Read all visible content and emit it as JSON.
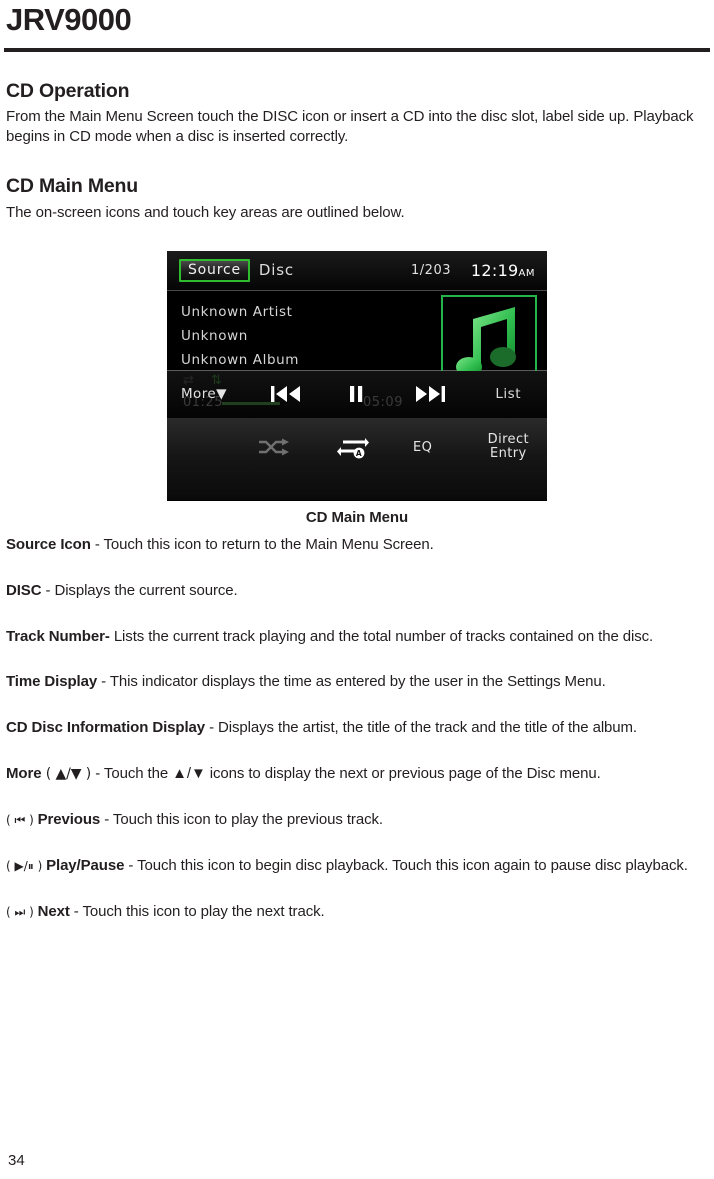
{
  "header": {
    "model_title": "JRV9000"
  },
  "sections": [
    {
      "heading": "CD Operation",
      "body": "From the Main Menu Screen touch the DISC icon or insert a CD into the disc slot, label side up. Playback begins in CD mode when a disc is inserted correctly."
    },
    {
      "heading": "CD Main Menu",
      "body": "The on-screen icons and touch key areas are outlined below."
    }
  ],
  "figure": {
    "caption": "CD Main Menu",
    "device": {
      "source_button": "Source",
      "disc_label": "Disc",
      "track_number": "1/203",
      "time": "12:19",
      "time_ampm": "AM",
      "info_lines": [
        "Unknown Artist",
        "Unknown",
        "Unknown Album"
      ],
      "more_label": "More",
      "more_caret": "▼",
      "list_label": "List",
      "eq_label": "EQ",
      "direct_entry_line1": "Direct",
      "direct_entry_line2": "Entry",
      "ghost_elapsed": "01:25",
      "ghost_total": "05:09",
      "accent_green": "#24b24a",
      "source_border_green": "#2fbd2f",
      "background": "#000000"
    }
  },
  "glossary": [
    {
      "term": "Source Icon",
      "prefix": "",
      "suffix": "",
      "description": " - Touch this icon to return to the Main Menu Screen."
    },
    {
      "term": "DISC",
      "prefix": "",
      "suffix": "",
      "description": " - Displays the current source."
    },
    {
      "term": "Track Number-",
      "prefix": "",
      "suffix": "",
      "description": " Lists the current track playing and the total number of tracks contained on the disc."
    },
    {
      "term": "Time Display",
      "prefix": "",
      "suffix": "",
      "description": " - This indicator displays the time as entered by the user in the Settings Menu."
    },
    {
      "term": "CD Disc Information Display",
      "prefix": "",
      "suffix": "",
      "description": " - Displays the artist, the title of the track and the title of the album."
    },
    {
      "term": "More",
      "prefix": "",
      "suffix": " ( ▲/▼ )",
      "description": " - Touch the ▲/▼ icons to display the next or previous page of the Disc menu."
    },
    {
      "term": "Previous",
      "prefix": "( ⏮ ) ",
      "suffix": "",
      "description": " - Touch this icon to play the previous track."
    },
    {
      "term": "Play/Pause",
      "prefix": "( ▶/⏸ ) ",
      "suffix": "",
      "description": " - Touch this icon to begin disc playback. Touch this icon again to pause disc playback."
    },
    {
      "term": "Next",
      "prefix": "( ⏭ ) ",
      "suffix": "",
      "description": " - Touch this icon to play the next track."
    }
  ],
  "footer": {
    "page_number": "34"
  }
}
